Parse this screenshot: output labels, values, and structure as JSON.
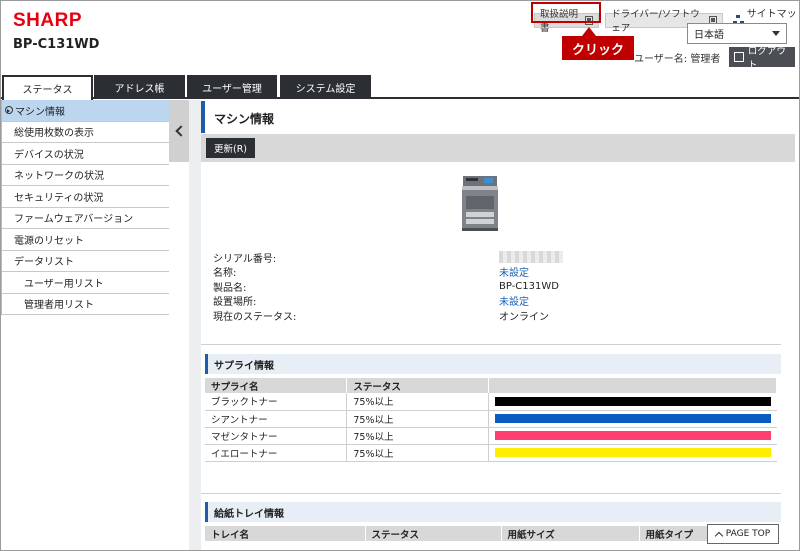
{
  "header": {
    "brand": "SHARP",
    "model": "BP-C131WD",
    "manual_link": "取扱説明書",
    "driver_link": "ドライバー/ソフトウェア",
    "sitemap": "サイトマップ",
    "callout": "クリック",
    "language": "日本語",
    "user": "ユーザー名: 管理者",
    "logout": "ログアウト"
  },
  "tabs": [
    "ステータス",
    "アドレス帳",
    "ユーザー管理",
    "システム設定"
  ],
  "sidebar": {
    "items": [
      {
        "label": "マシン情報"
      },
      {
        "label": "総使用枚数の表示"
      },
      {
        "label": "デバイスの状況"
      },
      {
        "label": "ネットワークの状況"
      },
      {
        "label": "セキュリティの状況"
      },
      {
        "label": "ファームウェアバージョン"
      },
      {
        "label": "電源のリセット"
      },
      {
        "label": "データリスト"
      },
      {
        "label": "ユーザー用リスト"
      },
      {
        "label": "管理者用リスト"
      }
    ]
  },
  "main": {
    "title": "マシン情報",
    "refresh": "更新(R)",
    "info": [
      {
        "label": "シリアル番号:",
        "value": ""
      },
      {
        "label": "名称:",
        "value": "未設定"
      },
      {
        "label": "製品名:",
        "value": "BP-C131WD"
      },
      {
        "label": "設置場所:",
        "value": "未設定"
      },
      {
        "label": "現在のステータス:",
        "value": "オンライン"
      }
    ],
    "supply": {
      "title": "サプライ情報",
      "headers": [
        "サプライ名",
        "ステータス"
      ],
      "rows": [
        {
          "name": "ブラックトナー",
          "status": "75%以上",
          "color": "#000000"
        },
        {
          "name": "シアントナー",
          "status": "75%以上",
          "color": "#0b5cc0"
        },
        {
          "name": "マゼンタトナー",
          "status": "75%以上",
          "color": "#ff3d6e"
        },
        {
          "name": "イエロートナー",
          "status": "75%以上",
          "color": "#ffee00"
        }
      ]
    },
    "tray": {
      "title": "給紙トレイ情報",
      "headers": [
        "トレイ名",
        "ステータス",
        "用紙サイズ",
        "用紙タイプ"
      ]
    }
  },
  "page_top": "PAGE TOP"
}
